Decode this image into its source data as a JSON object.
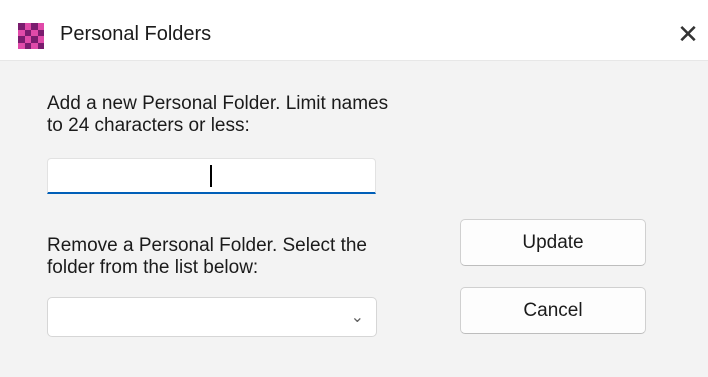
{
  "window": {
    "title": "Personal Folders",
    "close_glyph": "✕",
    "icon": "checkered-app-icon"
  },
  "add_section": {
    "label": "Add a new Personal Folder. Limit names to 24 characters or less:",
    "input_value": ""
  },
  "remove_section": {
    "label": "Remove a Personal Folder. Select the folder from the list below:",
    "selected_value": "",
    "chevron_glyph": "⌄"
  },
  "buttons": {
    "update_label": "Update",
    "cancel_label": "Cancel"
  },
  "colors": {
    "accent": "#005fb8",
    "icon_dark": "#7a1c6e",
    "icon_light": "#e04aa9",
    "dialog_bg": "#f3f3f3"
  }
}
